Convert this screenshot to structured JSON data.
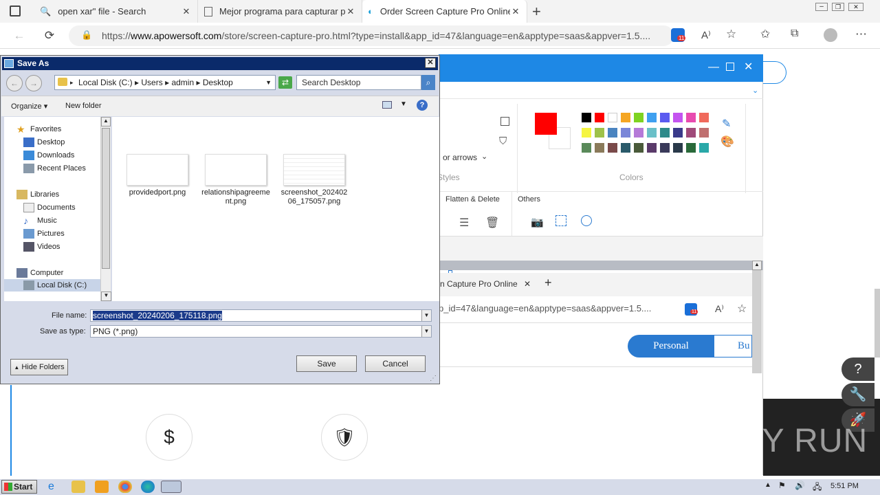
{
  "browser": {
    "tabs": [
      {
        "title": "open xar\" file - Search"
      },
      {
        "title": "Mejor programa para capturar pa"
      },
      {
        "title": "Order Screen Capture Pro Online"
      }
    ],
    "url_prefix": "https://",
    "url_domain": "www.apowersoft.com",
    "url_rest": "/store/screen-capture-pro.html?type=install&app_id=47&language=en&apptype=saas&appver=1.5....",
    "extension_badge": "11"
  },
  "capture_app": {
    "shape_label": "or arrows",
    "styles_label": "Styles",
    "colors_label": "Colors",
    "flatten_label": "Flatten & Delete",
    "others_label": "Others",
    "primary_color": "#ff0000",
    "palette": [
      "#000000",
      "#ff0000",
      "#ffffff",
      "#f5a623",
      "#7ed321",
      "#3fa0f0",
      "#5b5bf0",
      "#c454f0",
      "#e84bb0",
      "#f06a5c",
      "#f5f542",
      "#9ec24a",
      "#4a84c0",
      "#7a86d8",
      "#b57ad8",
      "#6ac0c8",
      "#2e8a8a",
      "#3a3a8a",
      "#a04a7a",
      "#c07070",
      "#5a8a5a",
      "#8a7a5a",
      "#7a4a4a",
      "#2a5a6a",
      "#4a5a3a",
      "#5a3a6a",
      "#3a3a5a",
      "#2a3a4a",
      "#2a6a3a",
      "#2aa8a8"
    ],
    "inner_tab_title": "n Capture Pro Online",
    "inner_url": "p_id=47&language=en&apptype=saas&appver=1.5....",
    "inner_badge": "11",
    "personal_label": "Personal",
    "business_label": "Bu"
  },
  "dialog": {
    "title": "Save As",
    "breadcrumb": [
      "Local Disk (C:)",
      "Users",
      "admin",
      "Desktop"
    ],
    "search_placeholder": "Search Desktop",
    "organize_label": "Organize",
    "new_folder_label": "New folder",
    "nav": {
      "favorites": "Favorites",
      "desktop": "Desktop",
      "downloads": "Downloads",
      "recent": "Recent Places",
      "libraries": "Libraries",
      "documents": "Documents",
      "music": "Music",
      "pictures": "Pictures",
      "videos": "Videos",
      "computer": "Computer",
      "localdisk": "Local Disk (C:)"
    },
    "files": [
      {
        "name": "providedport.png"
      },
      {
        "name": "relationshipagreement.png"
      },
      {
        "name": "screenshot_20240206_175057.png"
      }
    ],
    "file_name_label": "File name:",
    "file_name_value": "screenshot_20240206_175118.png",
    "save_type_label": "Save as type:",
    "save_type_value": "PNG (*.png)",
    "hide_folders_label": "Hide Folders",
    "save_label": "Save",
    "cancel_label": "Cancel"
  },
  "taskbar": {
    "start_label": "Start",
    "clock": "5:51 PM"
  },
  "watermark": "ANY RUN"
}
